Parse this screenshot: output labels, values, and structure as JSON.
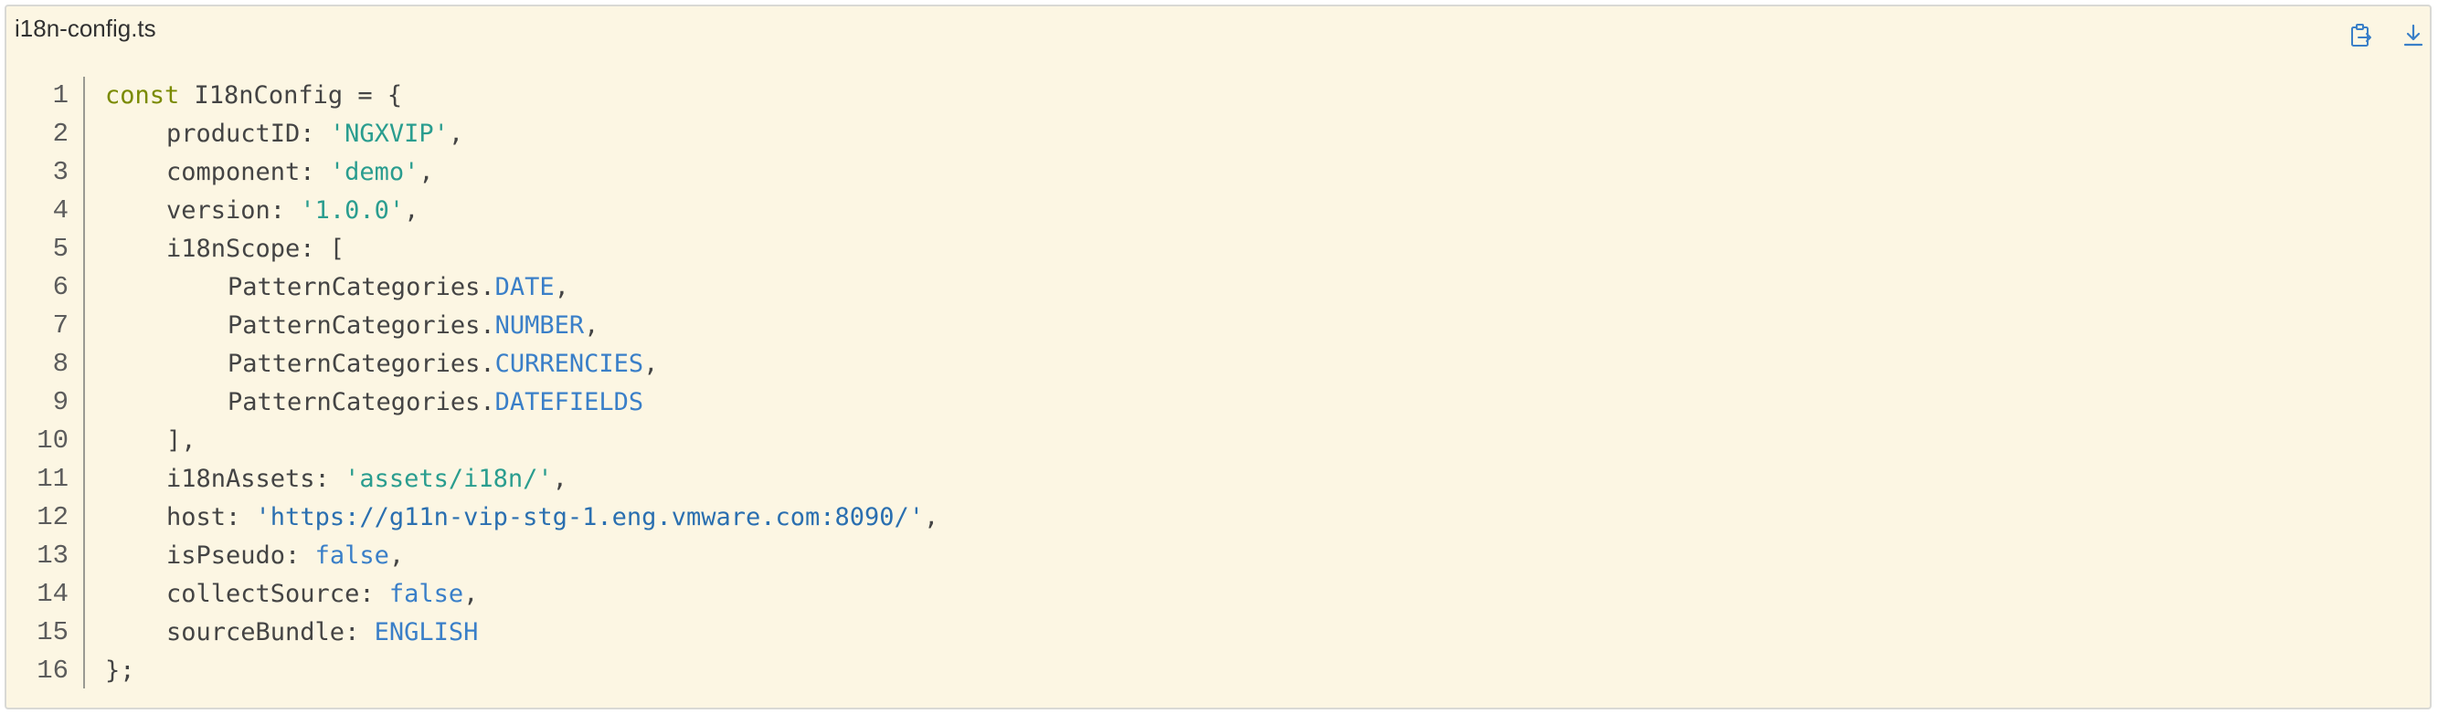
{
  "file": {
    "name": "i18n-config.ts"
  },
  "toolbar": {
    "copy_icon": "copy-to-clipboard-icon",
    "download_icon": "download-icon"
  },
  "code": {
    "line_numbers": [
      "1",
      "2",
      "3",
      "4",
      "5",
      "6",
      "7",
      "8",
      "9",
      "10",
      "11",
      "12",
      "13",
      "14",
      "15",
      "16"
    ],
    "l1": {
      "kw": "const",
      "rest": " I18nConfig = {"
    },
    "l2": {
      "key": "productID: ",
      "val": "'NGXVIP'",
      "end": ","
    },
    "l3": {
      "key": "component: ",
      "val": "'demo'",
      "end": ","
    },
    "l4": {
      "key": "version: ",
      "val": "'1.0.0'",
      "end": ","
    },
    "l5": {
      "text": "i18nScope: ["
    },
    "l6": {
      "obj": "PatternCategories.",
      "prop": "DATE",
      "end": ","
    },
    "l7": {
      "obj": "PatternCategories.",
      "prop": "NUMBER",
      "end": ","
    },
    "l8": {
      "obj": "PatternCategories.",
      "prop": "CURRENCIES",
      "end": ","
    },
    "l9": {
      "obj": "PatternCategories.",
      "prop": "DATEFIELDS",
      "end": ""
    },
    "l10": {
      "text": "],"
    },
    "l11": {
      "key": "i18nAssets: ",
      "val": "'assets/i18n/'",
      "end": ","
    },
    "l12": {
      "key": "host: ",
      "val": "'https://g11n-vip-stg-1.eng.vmware.com:8090/'",
      "end": ","
    },
    "l13": {
      "key": "isPseudo: ",
      "val": "false",
      "end": ","
    },
    "l14": {
      "key": "collectSource: ",
      "val": "false",
      "end": ","
    },
    "l15": {
      "key": "sourceBundle: ",
      "val": "ENGLISH",
      "end": ""
    },
    "l16": {
      "text": "};"
    }
  },
  "colors": {
    "background": "#fcf6e3",
    "keyword": "#7a8a00",
    "string": "#2a9d8f",
    "property": "#3a7fc8",
    "icon": "#3a7fc8"
  }
}
